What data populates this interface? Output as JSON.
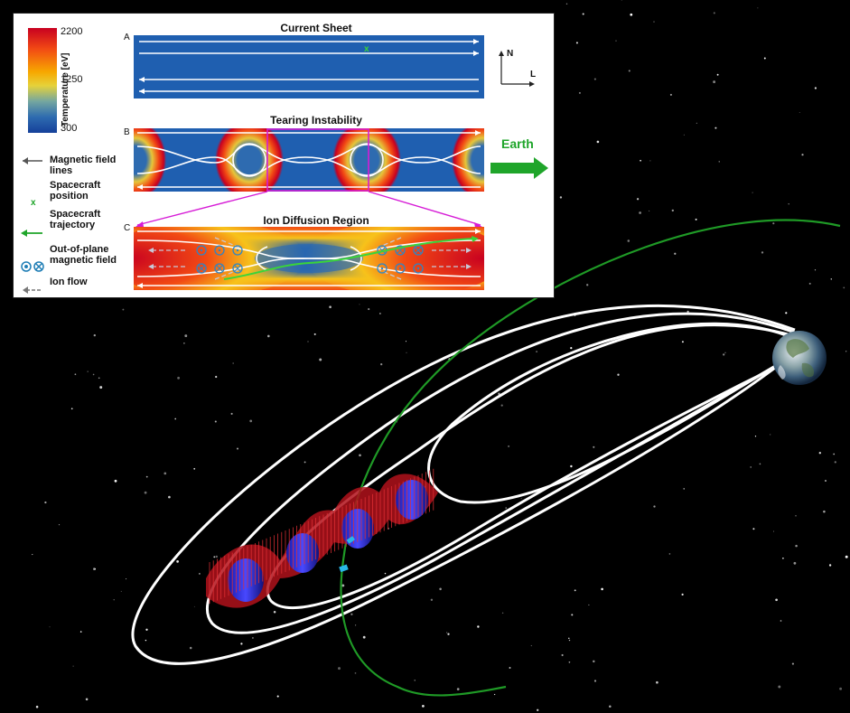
{
  "colorbar": {
    "max": "2200",
    "mid": "1250",
    "min": "300",
    "label": "Temperature [eV]",
    "colors": [
      "#c80020",
      "#f24a14",
      "#f7a800",
      "#e6d23a",
      "#74a6a0",
      "#2e6bb0",
      "#15409a"
    ]
  },
  "legend": {
    "magnetic_field": "Magnetic field lines",
    "spacecraft_position": "Spacecraft position",
    "spacecraft_trajectory": "Spacecraft trajectory",
    "out_of_plane": "Out-of-plane magnetic field",
    "ion_flow": "Ion flow"
  },
  "panels": {
    "a": {
      "letter": "A",
      "title": "Current Sheet"
    },
    "b": {
      "letter": "B",
      "title": "Tearing Instability"
    },
    "c": {
      "letter": "C",
      "title": "Ion Diffusion Region"
    }
  },
  "axes": {
    "north": "N",
    "length": "L"
  },
  "earth_label": "Earth",
  "colors": {
    "trajectory": "#1fa52a",
    "field_lines": "#ffffff",
    "zoom_lines": "#d61bd6",
    "sheet_blue": "#1f5fb0"
  }
}
